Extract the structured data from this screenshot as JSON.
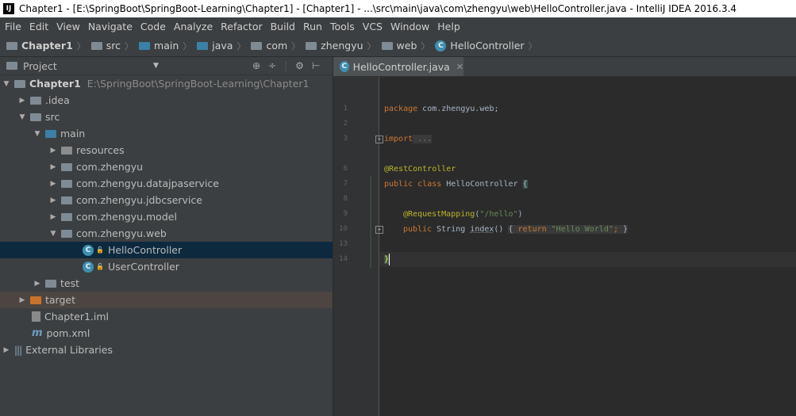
{
  "window": {
    "title": "Chapter1 - [E:\\SpringBoot\\SpringBoot-Learning\\Chapter1] - [Chapter1] - ...\\src\\main\\java\\com\\zhengyu\\web\\HelloController.java - IntelliJ IDEA 2016.3.4",
    "app_icon": "IJ"
  },
  "menu": [
    "File",
    "Edit",
    "View",
    "Navigate",
    "Code",
    "Analyze",
    "Refactor",
    "Build",
    "Run",
    "Tools",
    "VCS",
    "Window",
    "Help"
  ],
  "breadcrumb": [
    "Chapter1",
    "src",
    "main",
    "java",
    "com",
    "zhengyu",
    "web",
    "HelloController"
  ],
  "project_panel": {
    "title": "Project",
    "tree": [
      {
        "label": "Chapter1",
        "path": "E:\\SpringBoot\\SpringBoot-Learning\\Chapter1",
        "arrow": "▼",
        "icon": "module-folder-icon"
      },
      {
        "label": ".idea",
        "arrow": "▶",
        "icon": "folder-icon"
      },
      {
        "label": "src",
        "arrow": "▼",
        "icon": "folder-icon"
      },
      {
        "label": "main",
        "arrow": "▼",
        "icon": "source-folder-icon"
      },
      {
        "label": "resources",
        "arrow": "▶",
        "icon": "resources-folder-icon"
      },
      {
        "label": "com.zhengyu",
        "arrow": "▶",
        "icon": "package-icon"
      },
      {
        "label": "com.zhengyu.datajpaservice",
        "arrow": "▶",
        "icon": "package-icon"
      },
      {
        "label": "com.zhengyu.jdbcservice",
        "arrow": "▶",
        "icon": "package-icon"
      },
      {
        "label": "com.zhengyu.model",
        "arrow": "▶",
        "icon": "package-icon"
      },
      {
        "label": "com.zhengyu.web",
        "arrow": "▼",
        "icon": "package-icon"
      },
      {
        "label": "HelloController",
        "arrow": "",
        "icon": "class-icon",
        "selected": true
      },
      {
        "label": "UserController",
        "arrow": "",
        "icon": "class-icon"
      },
      {
        "label": "test",
        "arrow": "▶",
        "icon": "folder-icon"
      },
      {
        "label": "target",
        "arrow": "▶",
        "icon": "excluded-folder-icon",
        "highlight": true
      },
      {
        "label": "Chapter1.iml",
        "arrow": "",
        "icon": "iml-file-icon"
      },
      {
        "label": "pom.xml",
        "arrow": "",
        "icon": "maven-file-icon"
      },
      {
        "label": "External Libraries",
        "arrow": "▶",
        "icon": "libraries-icon"
      }
    ]
  },
  "editor": {
    "tab": "HelloController.java",
    "line_numbers": [
      "1",
      "2",
      "3",
      "6",
      "7",
      "8",
      "9",
      "10",
      "13",
      "14"
    ],
    "lines": {
      "l1_kw": "package",
      "l1_rest": " com.zhengyu.web;",
      "l3_kw": "import",
      "l3_rest": " ...",
      "l6_an": "@RestController",
      "l7_kw": "public class",
      "l7_rest": " HelloController ",
      "l7_brace": "{",
      "l9_an": "@RequestMapping",
      "l9_p1": "(",
      "l9_str": "\"/hello\"",
      "l9_p2": ")",
      "l10_kw": "public",
      "l10_rest": " String ",
      "l10_method": "index",
      "l10_p": "() ",
      "l10_b1": "{ ",
      "l10_ret": "return",
      "l10_str": " \"Hello World\"",
      "l10_semi": "; ",
      "l10_b2": "}",
      "l14_brace": "}"
    }
  },
  "colors": {
    "keyword": "#cc7832",
    "annotation": "#bbb529",
    "string": "#6a8759",
    "selection": "#0d293e"
  }
}
